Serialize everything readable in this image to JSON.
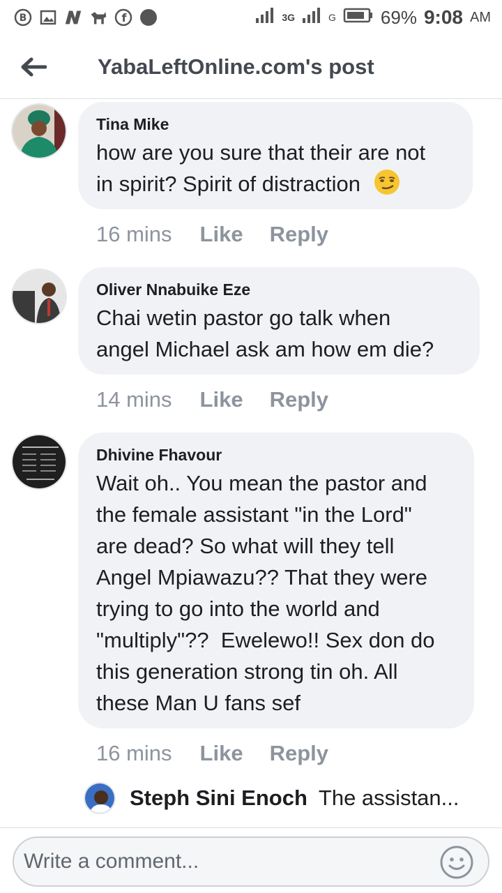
{
  "status_bar": {
    "battery": "69%",
    "time": "9:08",
    "ampm": "AM",
    "network_1": "3G",
    "network_2": "G"
  },
  "header": {
    "title": "YabaLeftOnline.com's post"
  },
  "comments": [
    {
      "author": "Tina Mike",
      "lines": [
        "how are you sure that their are not",
        "in spirit? Spirit of distraction"
      ],
      "emoji": "smirk",
      "time": "16 mins",
      "like": "Like",
      "reply": "Reply"
    },
    {
      "author": "Oliver Nnabuike Eze",
      "lines": [
        "Chai wetin pastor go talk when",
        "angel Michael ask am how em die?"
      ],
      "time": "14 mins",
      "like": "Like",
      "reply": "Reply"
    },
    {
      "author": "Dhivine Fhavour",
      "lines": [
        "Wait oh.. You mean the pastor and",
        "the female assistant \"in the Lord\"",
        "are dead? So what will they tell",
        "Angel Mpiawazu?? That they were",
        "trying to go into the world and",
        "\"multiply\"??  Ewelewo!! Sex don do",
        "this generation strong tin oh. All",
        "these Man U fans sef"
      ],
      "time": "16 mins",
      "like": "Like",
      "reply": "Reply"
    }
  ],
  "reply_preview": {
    "author": "Steph Sini Enoch",
    "text": "The assistan..."
  },
  "composer": {
    "placeholder": "Write a comment...",
    "emoji_icon": "smiley-icon"
  }
}
